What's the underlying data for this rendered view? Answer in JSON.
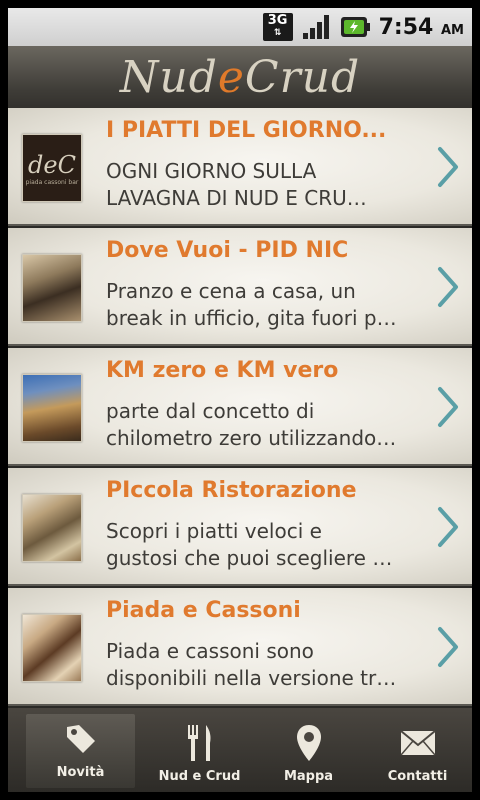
{
  "status_bar": {
    "network": "3G",
    "time": "7:54",
    "ampm": "AM"
  },
  "header": {
    "logo": {
      "part1": "Nud",
      "part2": "e",
      "part3": "Crud"
    }
  },
  "items": [
    {
      "title": "I PIATTI DEL GIORNO...",
      "desc_line1": "OGNI GIORNO SULLA",
      "desc_line2": "LAVAGNA DI NUD E CRU…",
      "thumb": {
        "type": "logo",
        "text": "deC",
        "caption": "piada cassoni bar"
      }
    },
    {
      "title": "Dove Vuoi - PID NIC",
      "desc_line1": "Pranzo e cena a casa, un",
      "desc_line2": "break in ufficio, gita fuori p…",
      "thumb": {
        "type": "photo"
      }
    },
    {
      "title": "KM zero e KM vero",
      "desc_line1": "parte dal concetto di",
      "desc_line2": "chilometro zero utilizzando…",
      "thumb": {
        "type": "photo"
      }
    },
    {
      "title": "PIccola Ristorazione",
      "desc_line1": "Scopri i piatti veloci e",
      "desc_line2": "gustosi che puoi scegliere …",
      "thumb": {
        "type": "photo"
      }
    },
    {
      "title": "Piada e Cassoni",
      "desc_line1": "Piada e cassoni sono",
      "desc_line2": "disponibili nella versione tr…",
      "thumb": {
        "type": "photo"
      }
    }
  ],
  "tabbar": [
    {
      "label": "Novità",
      "icon": "tag-icon",
      "active": true
    },
    {
      "label": "Nud e Crud",
      "icon": "fork-knife-icon",
      "active": false
    },
    {
      "label": "Mappa",
      "icon": "map-pin-icon",
      "active": false
    },
    {
      "label": "Contatti",
      "icon": "envelope-icon",
      "active": false
    }
  ],
  "colors": {
    "accent": "#e07a2e",
    "chevron": "#5a9fa6"
  }
}
